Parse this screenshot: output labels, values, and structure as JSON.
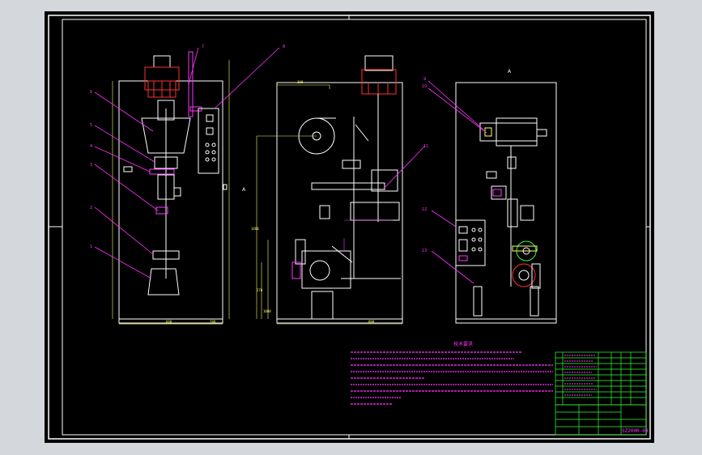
{
  "drawing": {
    "view_label": "A",
    "center_label": "A",
    "balloons": [
      "1",
      "2",
      "3",
      "4",
      "5",
      "6",
      "7",
      "8",
      "9",
      "10",
      "11",
      "12",
      "13"
    ],
    "notes_title": "技术要求",
    "drawing_number": "SZ2000-00",
    "dimensions": {
      "front_width": "600",
      "front_right": "280",
      "side_top": "300",
      "side_height": "1400",
      "side_bottom": "800",
      "side_left_small": "270",
      "side_left_big": "1000"
    }
  },
  "colors": {
    "background": "#d4d8dc",
    "sheet": "#000000",
    "outline": "#ffffff",
    "leader": "#ff33ff",
    "accent_red": "#ff3030",
    "dimension_yellow": "#ffff66",
    "table_green": "#33ff33",
    "component_green": "#33ff33"
  }
}
